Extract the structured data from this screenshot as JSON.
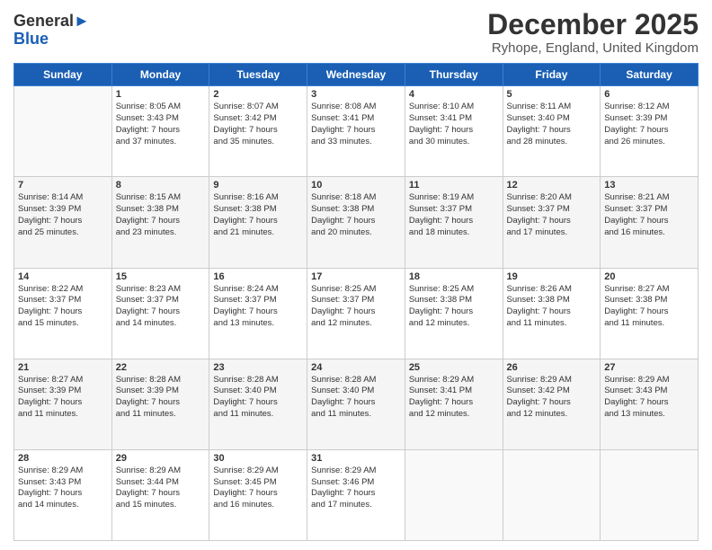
{
  "header": {
    "logo_line1": "General",
    "logo_line2": "Blue",
    "month": "December 2025",
    "location": "Ryhope, England, United Kingdom"
  },
  "days_of_week": [
    "Sunday",
    "Monday",
    "Tuesday",
    "Wednesday",
    "Thursday",
    "Friday",
    "Saturday"
  ],
  "weeks": [
    [
      {
        "day": "",
        "info": ""
      },
      {
        "day": "1",
        "info": "Sunrise: 8:05 AM\nSunset: 3:43 PM\nDaylight: 7 hours\nand 37 minutes."
      },
      {
        "day": "2",
        "info": "Sunrise: 8:07 AM\nSunset: 3:42 PM\nDaylight: 7 hours\nand 35 minutes."
      },
      {
        "day": "3",
        "info": "Sunrise: 8:08 AM\nSunset: 3:41 PM\nDaylight: 7 hours\nand 33 minutes."
      },
      {
        "day": "4",
        "info": "Sunrise: 8:10 AM\nSunset: 3:41 PM\nDaylight: 7 hours\nand 30 minutes."
      },
      {
        "day": "5",
        "info": "Sunrise: 8:11 AM\nSunset: 3:40 PM\nDaylight: 7 hours\nand 28 minutes."
      },
      {
        "day": "6",
        "info": "Sunrise: 8:12 AM\nSunset: 3:39 PM\nDaylight: 7 hours\nand 26 minutes."
      }
    ],
    [
      {
        "day": "7",
        "info": "Sunrise: 8:14 AM\nSunset: 3:39 PM\nDaylight: 7 hours\nand 25 minutes."
      },
      {
        "day": "8",
        "info": "Sunrise: 8:15 AM\nSunset: 3:38 PM\nDaylight: 7 hours\nand 23 minutes."
      },
      {
        "day": "9",
        "info": "Sunrise: 8:16 AM\nSunset: 3:38 PM\nDaylight: 7 hours\nand 21 minutes."
      },
      {
        "day": "10",
        "info": "Sunrise: 8:18 AM\nSunset: 3:38 PM\nDaylight: 7 hours\nand 20 minutes."
      },
      {
        "day": "11",
        "info": "Sunrise: 8:19 AM\nSunset: 3:37 PM\nDaylight: 7 hours\nand 18 minutes."
      },
      {
        "day": "12",
        "info": "Sunrise: 8:20 AM\nSunset: 3:37 PM\nDaylight: 7 hours\nand 17 minutes."
      },
      {
        "day": "13",
        "info": "Sunrise: 8:21 AM\nSunset: 3:37 PM\nDaylight: 7 hours\nand 16 minutes."
      }
    ],
    [
      {
        "day": "14",
        "info": "Sunrise: 8:22 AM\nSunset: 3:37 PM\nDaylight: 7 hours\nand 15 minutes."
      },
      {
        "day": "15",
        "info": "Sunrise: 8:23 AM\nSunset: 3:37 PM\nDaylight: 7 hours\nand 14 minutes."
      },
      {
        "day": "16",
        "info": "Sunrise: 8:24 AM\nSunset: 3:37 PM\nDaylight: 7 hours\nand 13 minutes."
      },
      {
        "day": "17",
        "info": "Sunrise: 8:25 AM\nSunset: 3:37 PM\nDaylight: 7 hours\nand 12 minutes."
      },
      {
        "day": "18",
        "info": "Sunrise: 8:25 AM\nSunset: 3:38 PM\nDaylight: 7 hours\nand 12 minutes."
      },
      {
        "day": "19",
        "info": "Sunrise: 8:26 AM\nSunset: 3:38 PM\nDaylight: 7 hours\nand 11 minutes."
      },
      {
        "day": "20",
        "info": "Sunrise: 8:27 AM\nSunset: 3:38 PM\nDaylight: 7 hours\nand 11 minutes."
      }
    ],
    [
      {
        "day": "21",
        "info": "Sunrise: 8:27 AM\nSunset: 3:39 PM\nDaylight: 7 hours\nand 11 minutes."
      },
      {
        "day": "22",
        "info": "Sunrise: 8:28 AM\nSunset: 3:39 PM\nDaylight: 7 hours\nand 11 minutes."
      },
      {
        "day": "23",
        "info": "Sunrise: 8:28 AM\nSunset: 3:40 PM\nDaylight: 7 hours\nand 11 minutes."
      },
      {
        "day": "24",
        "info": "Sunrise: 8:28 AM\nSunset: 3:40 PM\nDaylight: 7 hours\nand 11 minutes."
      },
      {
        "day": "25",
        "info": "Sunrise: 8:29 AM\nSunset: 3:41 PM\nDaylight: 7 hours\nand 12 minutes."
      },
      {
        "day": "26",
        "info": "Sunrise: 8:29 AM\nSunset: 3:42 PM\nDaylight: 7 hours\nand 12 minutes."
      },
      {
        "day": "27",
        "info": "Sunrise: 8:29 AM\nSunset: 3:43 PM\nDaylight: 7 hours\nand 13 minutes."
      }
    ],
    [
      {
        "day": "28",
        "info": "Sunrise: 8:29 AM\nSunset: 3:43 PM\nDaylight: 7 hours\nand 14 minutes."
      },
      {
        "day": "29",
        "info": "Sunrise: 8:29 AM\nSunset: 3:44 PM\nDaylight: 7 hours\nand 15 minutes."
      },
      {
        "day": "30",
        "info": "Sunrise: 8:29 AM\nSunset: 3:45 PM\nDaylight: 7 hours\nand 16 minutes."
      },
      {
        "day": "31",
        "info": "Sunrise: 8:29 AM\nSunset: 3:46 PM\nDaylight: 7 hours\nand 17 minutes."
      },
      {
        "day": "",
        "info": ""
      },
      {
        "day": "",
        "info": ""
      },
      {
        "day": "",
        "info": ""
      }
    ]
  ]
}
